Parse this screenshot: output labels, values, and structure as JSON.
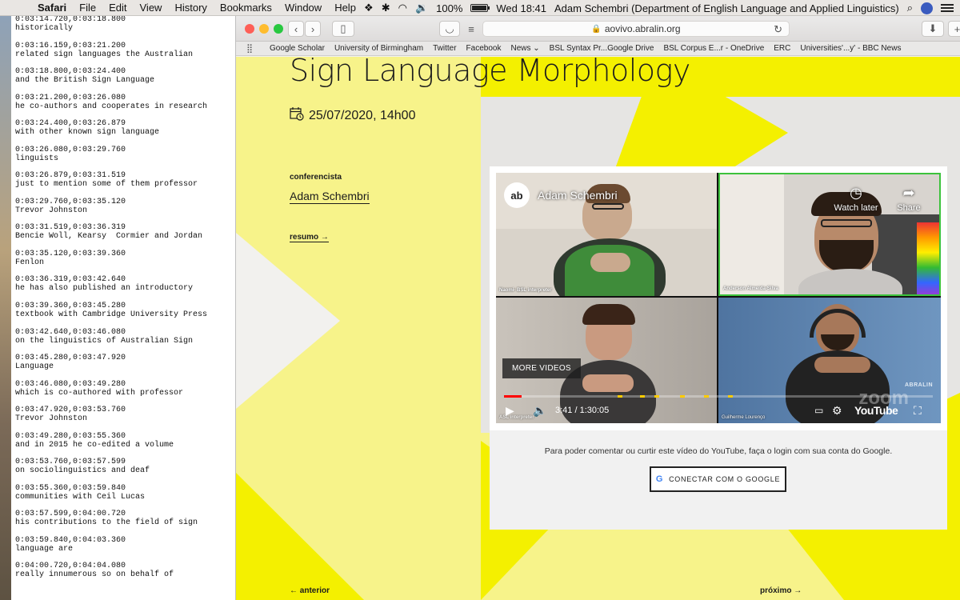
{
  "menubar": {
    "apple": "",
    "app": "Safari",
    "menus": [
      "File",
      "Edit",
      "View",
      "History",
      "Bookmarks",
      "Window",
      "Help"
    ],
    "battery_percent": "100%",
    "battery_level": 1.0,
    "clock": "Wed 18:41",
    "window_title": "Adam Schembri (Department of English Language and Applied Linguistics)"
  },
  "subtitles": [
    {
      "time": "0:03:14.720,0:03:18.800",
      "text": "historically"
    },
    {
      "time": "0:03:16.159,0:03:21.200",
      "text": "related sign languages the Australian"
    },
    {
      "time": "0:03:18.800,0:03:24.400",
      "text": "and the British Sign Language"
    },
    {
      "time": "0:03:21.200,0:03:26.080",
      "text": "he co-authors and cooperates in research"
    },
    {
      "time": "0:03:24.400,0:03:26.879",
      "text": "with other known sign language"
    },
    {
      "time": "0:03:26.080,0:03:29.760",
      "text": "linguists"
    },
    {
      "time": "0:03:26.879,0:03:31.519",
      "text": "just to mention some of them professor"
    },
    {
      "time": "0:03:29.760,0:03:35.120",
      "text": "Trevor Johnston"
    },
    {
      "time": "0:03:31.519,0:03:36.319",
      "text": "Bencie Woll, Kearsy  Cormier and Jordan"
    },
    {
      "time": "0:03:35.120,0:03:39.360",
      "text": "Fenlon"
    },
    {
      "time": "0:03:36.319,0:03:42.640",
      "text": "he has also published an introductory"
    },
    {
      "time": "0:03:39.360,0:03:45.280",
      "text": "textbook with Cambridge University Press"
    },
    {
      "time": "0:03:42.640,0:03:46.080",
      "text": "on the linguistics of Australian Sign"
    },
    {
      "time": "0:03:45.280,0:03:47.920",
      "text": "Language"
    },
    {
      "time": "0:03:46.080,0:03:49.280",
      "text": "which is co-authored with professor"
    },
    {
      "time": "0:03:47.920,0:03:53.760",
      "text": "Trevor Johnston"
    },
    {
      "time": "0:03:49.280,0:03:55.360",
      "text": "and in 2015 he co-edited a volume"
    },
    {
      "time": "0:03:53.760,0:03:57.599",
      "text": "on sociolinguistics and deaf"
    },
    {
      "time": "0:03:55.360,0:03:59.840",
      "text": "communities with Ceil Lucas"
    },
    {
      "time": "0:03:57.599,0:04:00.720",
      "text": "his contributions to the field of sign"
    },
    {
      "time": "0:03:59.840,0:04:03.360",
      "text": "language are"
    },
    {
      "time": "0:04:00.720,0:04:04.080",
      "text": "really innumerous so on behalf of"
    }
  ],
  "safari": {
    "url": "aovivo.abralin.org",
    "bookmarks": [
      "Google Scholar",
      "University of Birmingham",
      "Twitter",
      "Facebook",
      "News",
      "BSL Syntax Pr...Google Drive",
      "BSL Corpus E...r - OneDrive",
      "ERC",
      "Universities'...y' - BBC News"
    ]
  },
  "page": {
    "title": "Sign Language Morphology",
    "date": "25/07/2020, 14h00",
    "speaker_label": "conferencista",
    "speaker_name": "Adam Schembri",
    "summary_link": "resumo →",
    "prev_link": "← anterior",
    "next_link": "próximo →",
    "consent_text": "Para poder comentar ou curtir este vídeo do YouTube, faça o login com sua conta do Google.",
    "google_button": "CONECTAR COM O GOOGLE"
  },
  "video": {
    "logo": "ab",
    "channel_title": "Adam Schembri",
    "watch_later": "Watch later",
    "share": "Share",
    "more_videos": "MORE VIDEOS",
    "current_time": "3:41",
    "duration": "1:30:05",
    "progress": 0.041,
    "youtube": "YouTube",
    "watermark": "ABRALIN",
    "zoom_watermark": "zoom",
    "participants": [
      "Naomi- BSL interpreter",
      "Anderson Almeida-Silva",
      "ASL interpreter",
      "Guilherme Lourenço"
    ]
  },
  "colors": {
    "page_yellow": "#f7f38a",
    "bright_yellow": "#f4f000",
    "gray_shape": "#e6e5e3",
    "progress_red": "#ff0000",
    "chapter_yellow": "#ffcc00"
  }
}
